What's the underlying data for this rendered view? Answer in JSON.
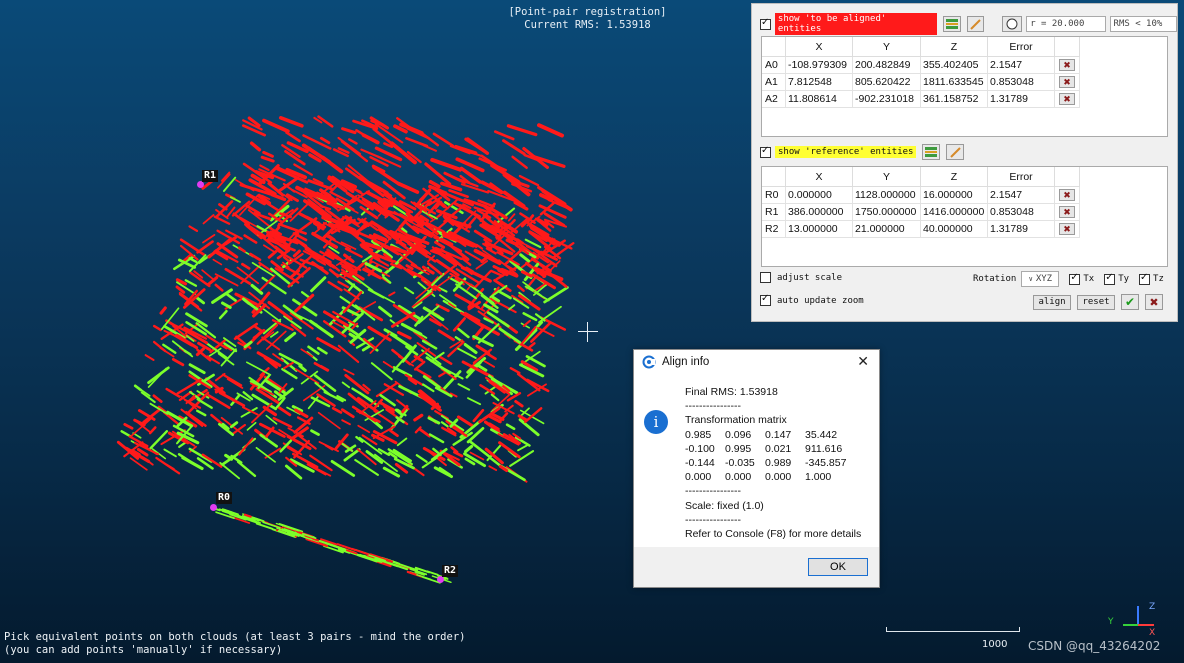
{
  "hud": {
    "title_line1": "[Point-pair registration]",
    "title_line2": "Current RMS: 1.53918",
    "instruction_line1": "Pick equivalent points on both clouds (at least 3 pairs - mind the order)",
    "instruction_line2": "(you can add points 'manually' if necessary)",
    "scale_value": "1000",
    "watermark": "CSDN @qq_43264202"
  },
  "point_labels": {
    "r1": "R1",
    "r0": "R0",
    "r2": "R2"
  },
  "axes": {
    "y": "Y",
    "x": "X",
    "z": "Z"
  },
  "panel": {
    "aligned_label": "show 'to be aligned' entities",
    "radius_value": "r = 20.000",
    "rms_value": "RMS < 10%",
    "reference_label": "show 'reference' entities",
    "columns": [
      "X",
      "Y",
      "Z",
      "Error"
    ],
    "aligned_rows": [
      {
        "id": "A0",
        "x": "-108.979309",
        "y": "200.482849",
        "z": "355.402405",
        "err": "2.1547"
      },
      {
        "id": "A1",
        "x": "7.812548",
        "y": "805.620422",
        "z": "1811.633545",
        "err": "0.853048"
      },
      {
        "id": "A2",
        "x": "11.808614",
        "y": "-902.231018",
        "z": "361.158752",
        "err": "1.31789"
      }
    ],
    "reference_rows": [
      {
        "id": "R0",
        "x": "0.000000",
        "y": "1128.000000",
        "z": "16.000000",
        "err": "2.1547"
      },
      {
        "id": "R1",
        "x": "386.000000",
        "y": "1750.000000",
        "z": "1416.000000",
        "err": "0.853048"
      },
      {
        "id": "R2",
        "x": "13.000000",
        "y": "21.000000",
        "z": "40.000000",
        "err": "1.31789"
      }
    ],
    "adjust_scale": "adjust scale",
    "rotation_label": "Rotation",
    "rotation_value": "XYZ",
    "tx": "Tx",
    "ty": "Ty",
    "tz": "Tz",
    "auto_update_zoom": "auto update zoom",
    "align_button": "align",
    "reset_button": "reset"
  },
  "dialog": {
    "title": "Align info",
    "final_rms": "Final RMS: 1.53918",
    "sep": "----------------",
    "matrix_title": "Transformation matrix",
    "matrix": [
      [
        "0.985",
        "0.096",
        "0.147",
        "35.442"
      ],
      [
        "-0.100",
        "0.995",
        "0.021",
        "911.616"
      ],
      [
        "-0.144",
        "-0.035",
        "0.989",
        "-345.857"
      ],
      [
        "0.000",
        "0.000",
        "0.000",
        "1.000"
      ]
    ],
    "scale": "Scale: fixed (1.0)",
    "console": "Refer to Console (F8) for more details",
    "ok": "OK"
  },
  "colors": {
    "aligned_cloud": "#ff1a1a",
    "reference_cloud": "#7cff2a",
    "picked_point": "#e03cf0",
    "aligned_tag": "#ff1a1a",
    "reference_tag": "#ffff33"
  }
}
